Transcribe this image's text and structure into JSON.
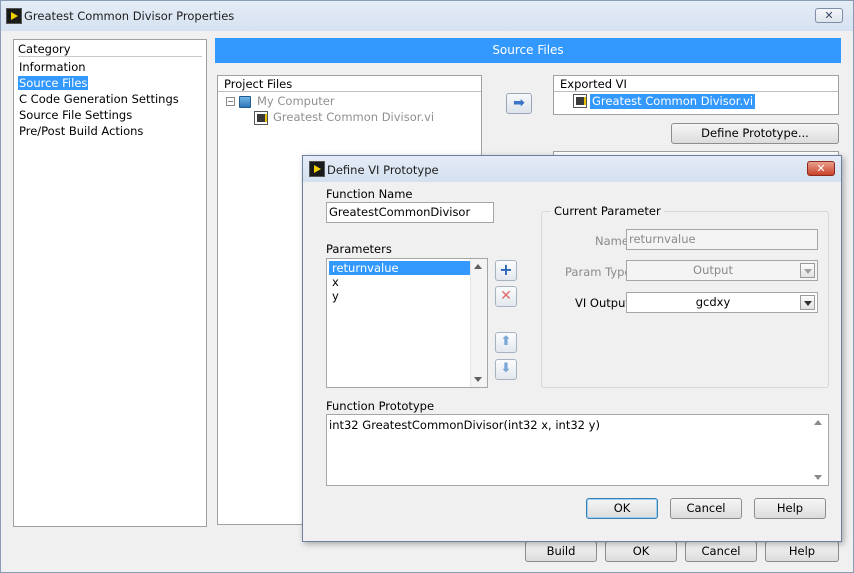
{
  "window": {
    "title": "Greatest Common Divisor Properties",
    "close_glyph": "✕"
  },
  "category": {
    "header": "Category",
    "items": [
      {
        "label": "Information"
      },
      {
        "label": "Source Files",
        "selected": true
      },
      {
        "label": "C Code Generation Settings"
      },
      {
        "label": "Source File Settings"
      },
      {
        "label": "Pre/Post Build Actions"
      }
    ]
  },
  "main": {
    "section_title": "Source Files",
    "project_files": {
      "header": "Project Files",
      "root": "My Computer",
      "child": "Greatest Common Divisor.vi"
    },
    "exported_vi": {
      "header": "Exported VI",
      "item": "Greatest Common Divisor.vi"
    },
    "define_prototype_label": "Define Prototype..."
  },
  "footer": {
    "build_label": "Build",
    "ok_label": "OK",
    "cancel_label": "Cancel",
    "help_label": "Help"
  },
  "dialog": {
    "title": "Define VI Prototype",
    "close_glyph": "✕",
    "function_name_label": "Function Name",
    "function_name_value": "GreatestCommonDivisor",
    "parameters_label": "Parameters",
    "parameters": [
      "returnvalue",
      "x",
      "y"
    ],
    "current_parameter": {
      "legend": "Current Parameter",
      "name_label": "Name",
      "name_value": "returnvalue",
      "param_type_label": "Param Type",
      "param_type_value": "Output",
      "vi_output_label": "VI Output",
      "vi_output_value": "gcdxy"
    },
    "function_prototype_label": "Function Prototype",
    "function_prototype_value": "int32 GreatestCommonDivisor(int32 x, int32 y)",
    "ok_label": "OK",
    "cancel_label": "Cancel",
    "help_label": "Help"
  },
  "colors": {
    "accent": "#3399ff",
    "add_icon": "#2a63b8",
    "remove_icon": "#e06a6a",
    "move_icon": "#7aa6d8"
  }
}
